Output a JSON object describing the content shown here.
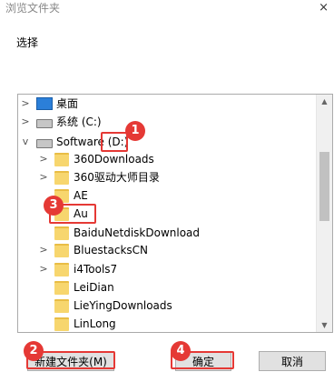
{
  "dialog": {
    "title": "浏览文件夹",
    "close_glyph": "×",
    "prompt": "选择"
  },
  "tree": {
    "items": [
      {
        "label": "桌面",
        "icon": "desktop-icon",
        "expander": ">"
      },
      {
        "label": "系统 (C:)",
        "icon": "drive-icon",
        "expander": ">"
      },
      {
        "label": "Software (D:)",
        "icon": "drive-icon",
        "expander": "v"
      },
      {
        "label": "360Downloads",
        "icon": "folder-icon",
        "expander": ">"
      },
      {
        "label": "360驱动大师目录",
        "icon": "folder-icon",
        "expander": ">"
      },
      {
        "label": "AE",
        "icon": "folder-icon",
        "expander": ""
      },
      {
        "label": "Au",
        "icon": "folder-icon",
        "expander": ""
      },
      {
        "label": "BaiduNetdiskDownload",
        "icon": "folder-icon",
        "expander": ""
      },
      {
        "label": "BluestacksCN",
        "icon": "folder-icon",
        "expander": ">"
      },
      {
        "label": "i4Tools7",
        "icon": "folder-icon",
        "expander": ">"
      },
      {
        "label": "LeiDian",
        "icon": "folder-icon",
        "expander": ""
      },
      {
        "label": "LieYingDownloads",
        "icon": "folder-icon",
        "expander": ""
      },
      {
        "label": "LinLong",
        "icon": "folder-icon",
        "expander": ""
      }
    ]
  },
  "buttons": {
    "new_folder": "新建文件夹(M)",
    "ok": "确定",
    "cancel": "取消"
  },
  "annotations": {
    "b1": "1",
    "b2": "2",
    "b3": "3",
    "b4": "4",
    "color": "#e53935"
  }
}
